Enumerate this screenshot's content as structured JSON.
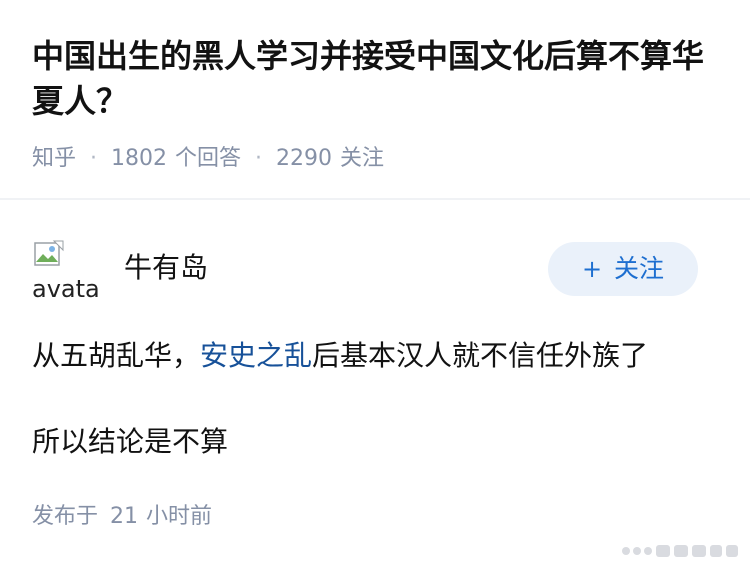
{
  "question": {
    "title": "中国出生的黑人学习并接受中国文化后算不算华夏人？",
    "source": "知乎",
    "separator": "·",
    "answer_count": "1802",
    "answer_label": "个回答",
    "follower_count": "2290",
    "follower_label": "关注"
  },
  "answer": {
    "avatar_alt": "avatar",
    "author": "牛有岛",
    "follow_button": "关注",
    "follow_icon": "plus-icon",
    "paragraph1": {
      "before": "从五胡乱华，",
      "link": "安史之乱",
      "after": "后基本汉人就不信任外族了"
    },
    "paragraph2": "所以结论是不算",
    "time_label": "发布于",
    "time_num": "21",
    "time_unit": "小时前"
  },
  "colors": {
    "title": "#121212",
    "meta": "#8590a6",
    "link": "#175199",
    "follow_bg": "#eaf1fa",
    "follow_text": "#1e6fd0"
  }
}
